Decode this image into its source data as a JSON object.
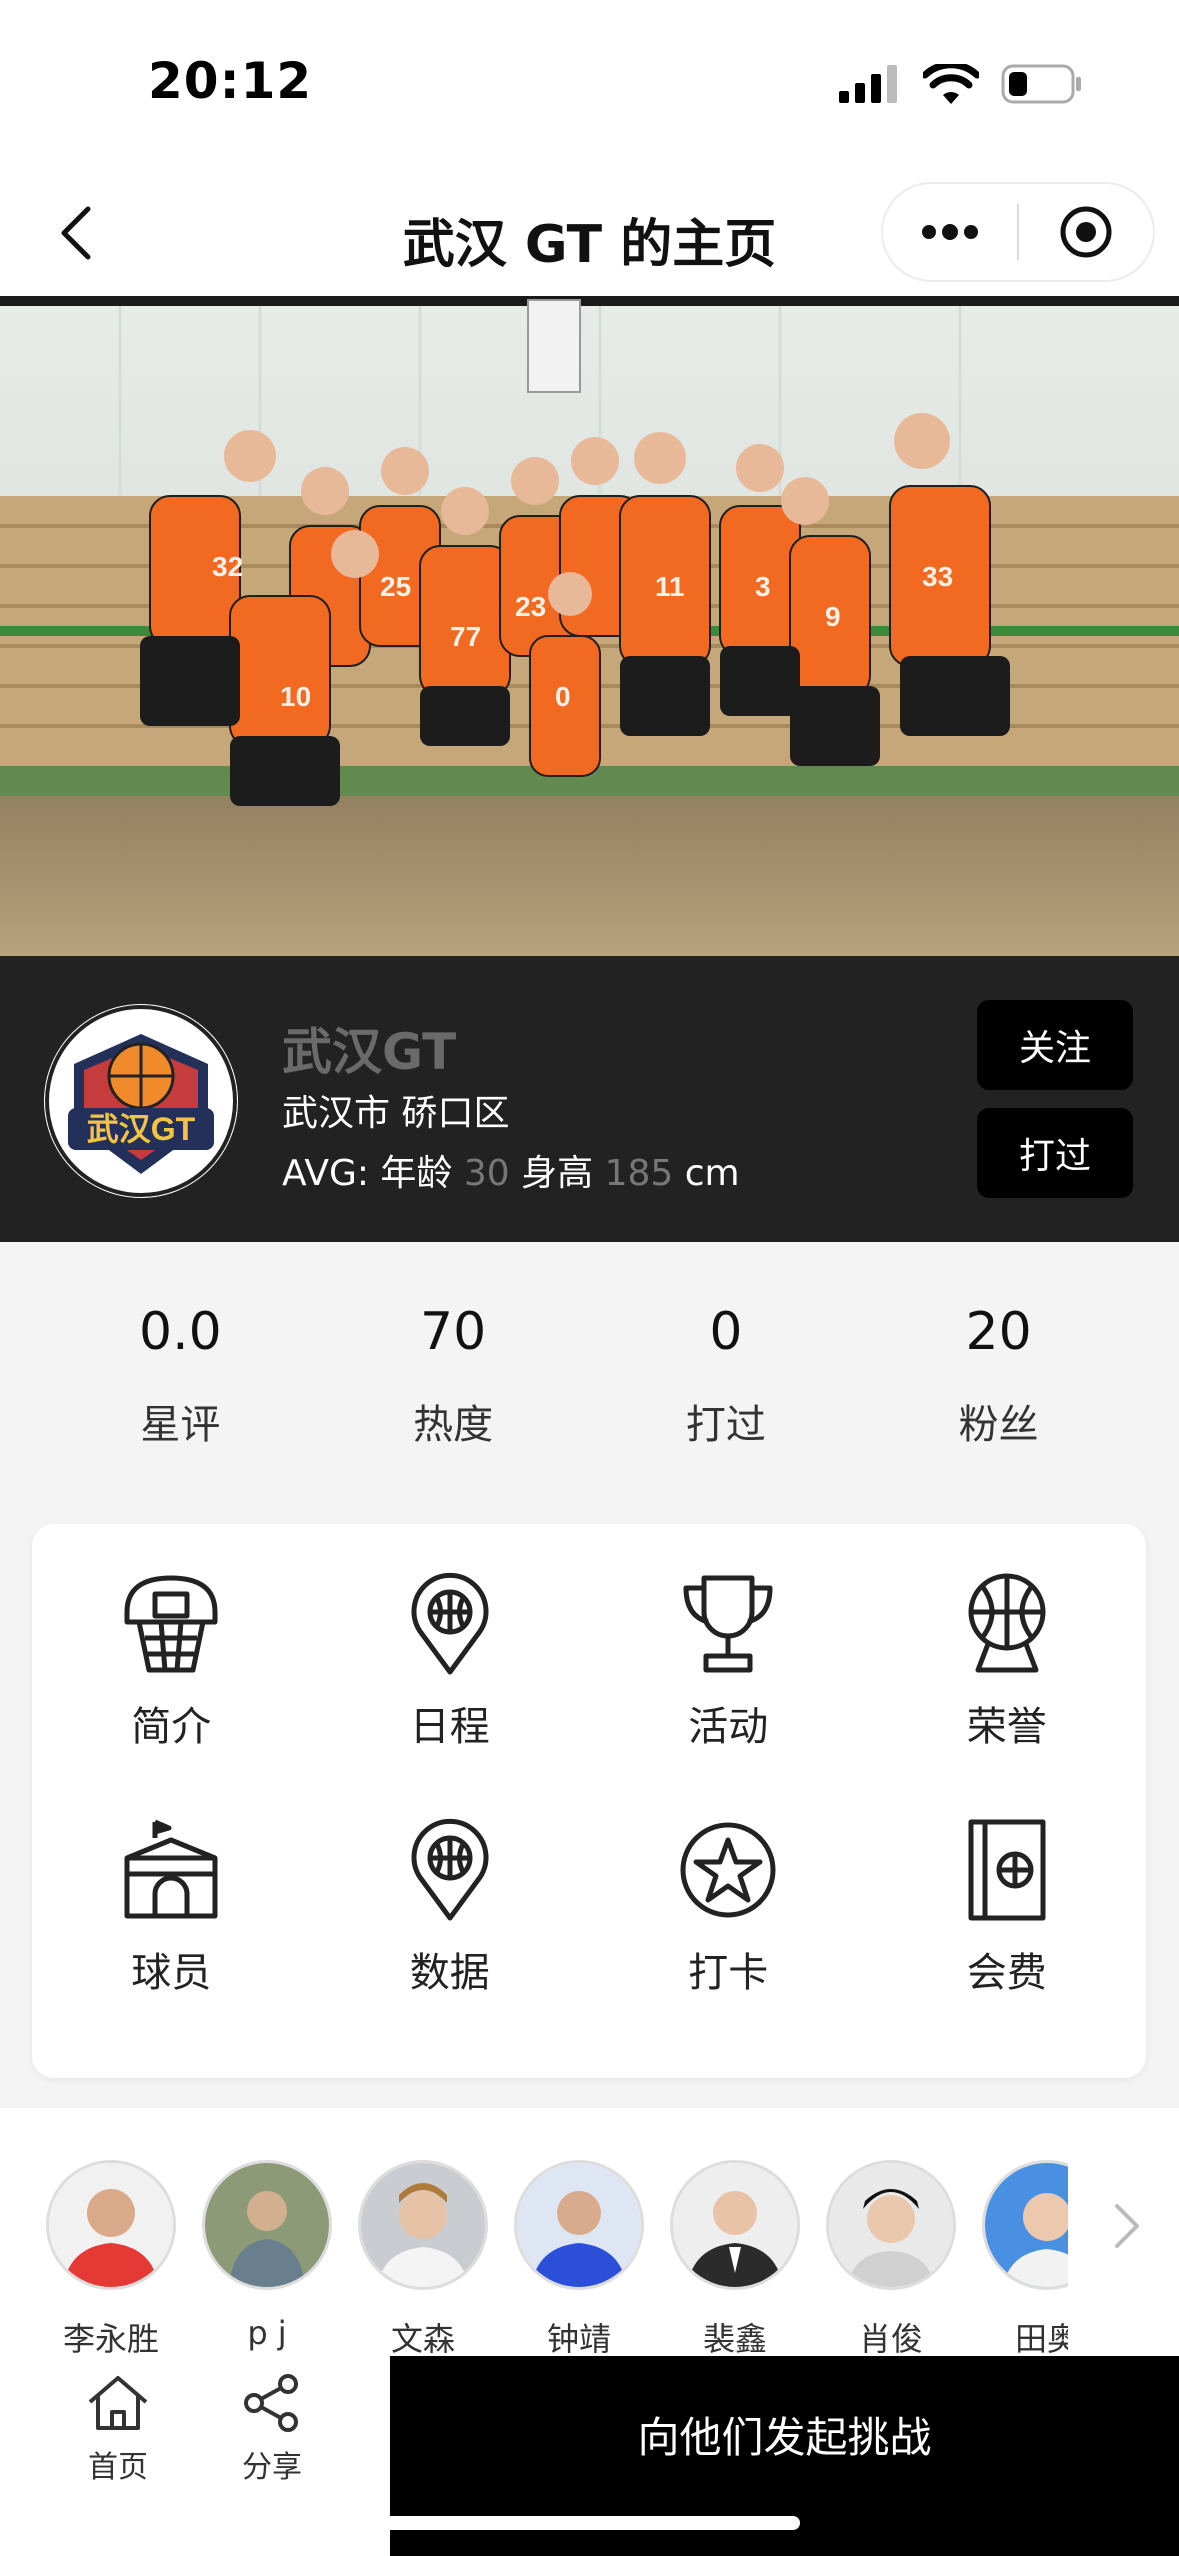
{
  "status_bar": {
    "time": "20:12"
  },
  "nav": {
    "title": "武汉 GT 的主页"
  },
  "team": {
    "name": "武汉GT",
    "location": "武汉市 硚口区",
    "avg_prefix": "AVG: 年龄 ",
    "avg_age": "30",
    "avg_height_label": " 身高 ",
    "avg_height": "185",
    "avg_unit": " cm",
    "follow_label": "关注",
    "played_label": "打过",
    "logo_text": "武汉GT"
  },
  "stats": [
    {
      "value": "0.0",
      "label": "星评"
    },
    {
      "value": "70",
      "label": "热度"
    },
    {
      "value": "0",
      "label": "打过"
    },
    {
      "value": "20",
      "label": "粉丝"
    }
  ],
  "features": [
    {
      "label": "简介",
      "icon": "basketball-hoop-icon"
    },
    {
      "label": "日程",
      "icon": "location-pin-ball-icon"
    },
    {
      "label": "活动",
      "icon": "trophy-icon"
    },
    {
      "label": "荣誉",
      "icon": "ball-trophy-icon"
    },
    {
      "label": "球员",
      "icon": "arena-icon"
    },
    {
      "label": "数据",
      "icon": "location-pin-ball-icon"
    },
    {
      "label": "打卡",
      "icon": "star-ball-icon"
    },
    {
      "label": "会费",
      "icon": "ball-card-icon"
    }
  ],
  "members": [
    {
      "name": "李永胜",
      "color": "#e53935"
    },
    {
      "name": "p j",
      "color": "#7a8a6a"
    },
    {
      "name": "文森",
      "color": "#9aa0a6"
    },
    {
      "name": "钟靖",
      "color": "#2b4fd8"
    },
    {
      "name": "裴鑫",
      "color": "#3b3b3b"
    },
    {
      "name": "肖俊",
      "color": "#cfcfcf"
    },
    {
      "name": "田奥",
      "color": "#4a90e2"
    }
  ],
  "bottom": {
    "home_label": "首页",
    "share_label": "分享",
    "challenge_label": "向他们发起挑战"
  },
  "colors": {
    "accent": "#000000",
    "band": "#222222",
    "jersey": "#f26a21"
  }
}
